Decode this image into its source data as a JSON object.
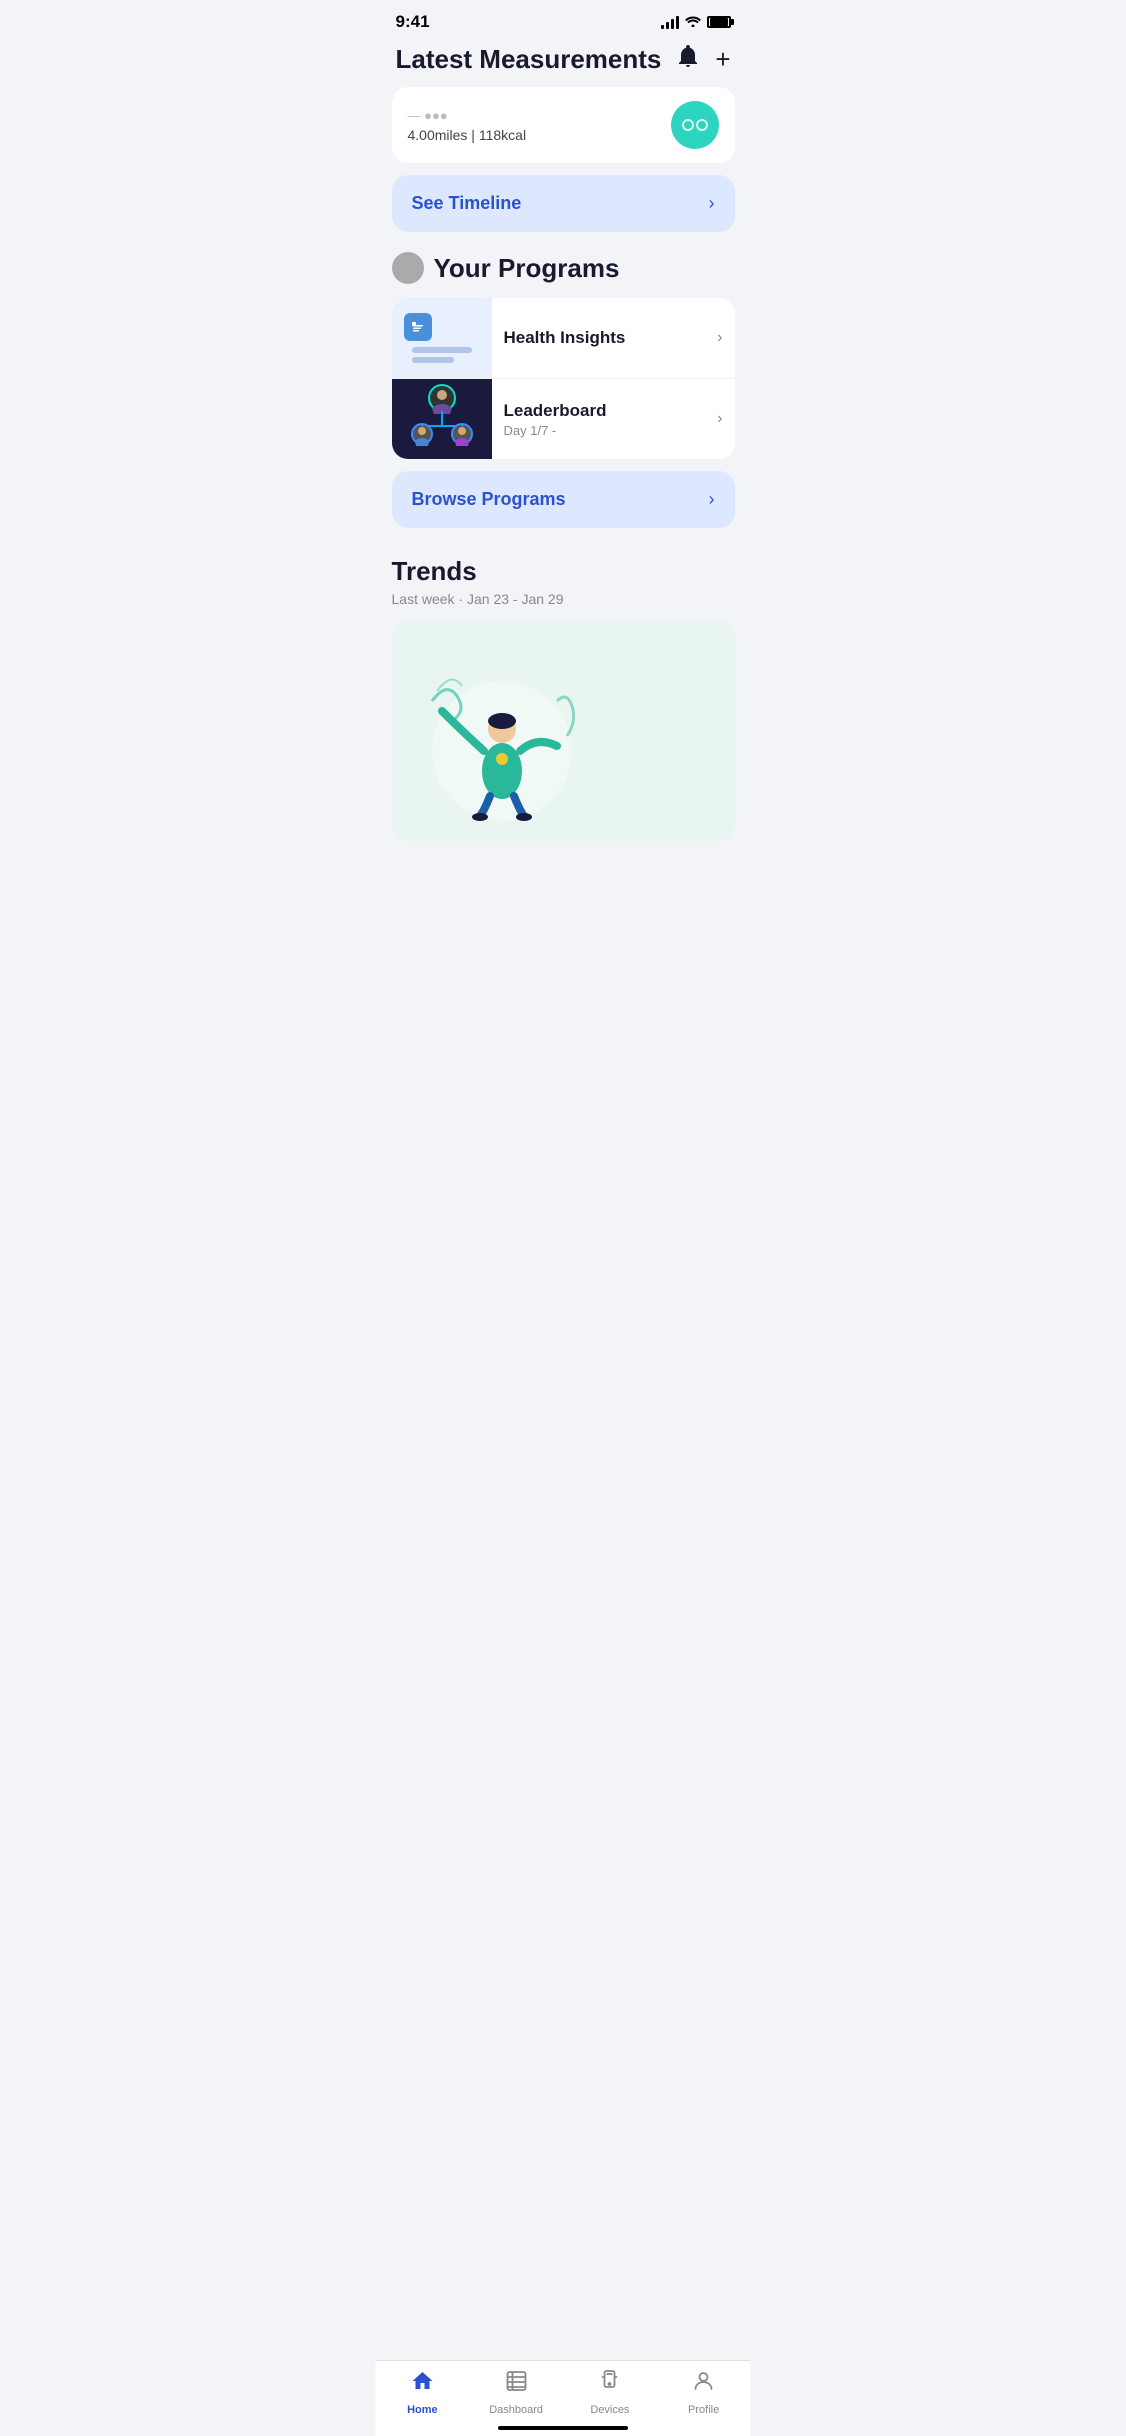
{
  "statusBar": {
    "time": "9:41"
  },
  "header": {
    "title": "Latest Measurements",
    "notificationLabel": "notifications",
    "addLabel": "add"
  },
  "activityCard": {
    "distance": "4.00miles | 118kcal"
  },
  "timelineButton": {
    "label": "See Timeline",
    "chevron": "›"
  },
  "programsSection": {
    "title": "Your Programs",
    "items": [
      {
        "name": "Health Insights",
        "sub": "",
        "type": "health"
      },
      {
        "name": "Leaderboard",
        "sub": "Day 1/7 -",
        "type": "leaderboard"
      }
    ],
    "browseLabel": "Browse Programs"
  },
  "trendsSection": {
    "title": "Trends",
    "subtitle": "Last week · Jan 23 - Jan 29"
  },
  "bottomNav": {
    "items": [
      {
        "label": "Home",
        "icon": "home",
        "active": true
      },
      {
        "label": "Dashboard",
        "icon": "dashboard",
        "active": false
      },
      {
        "label": "Devices",
        "icon": "devices",
        "active": false
      },
      {
        "label": "Profile",
        "icon": "profile",
        "active": false
      }
    ]
  }
}
